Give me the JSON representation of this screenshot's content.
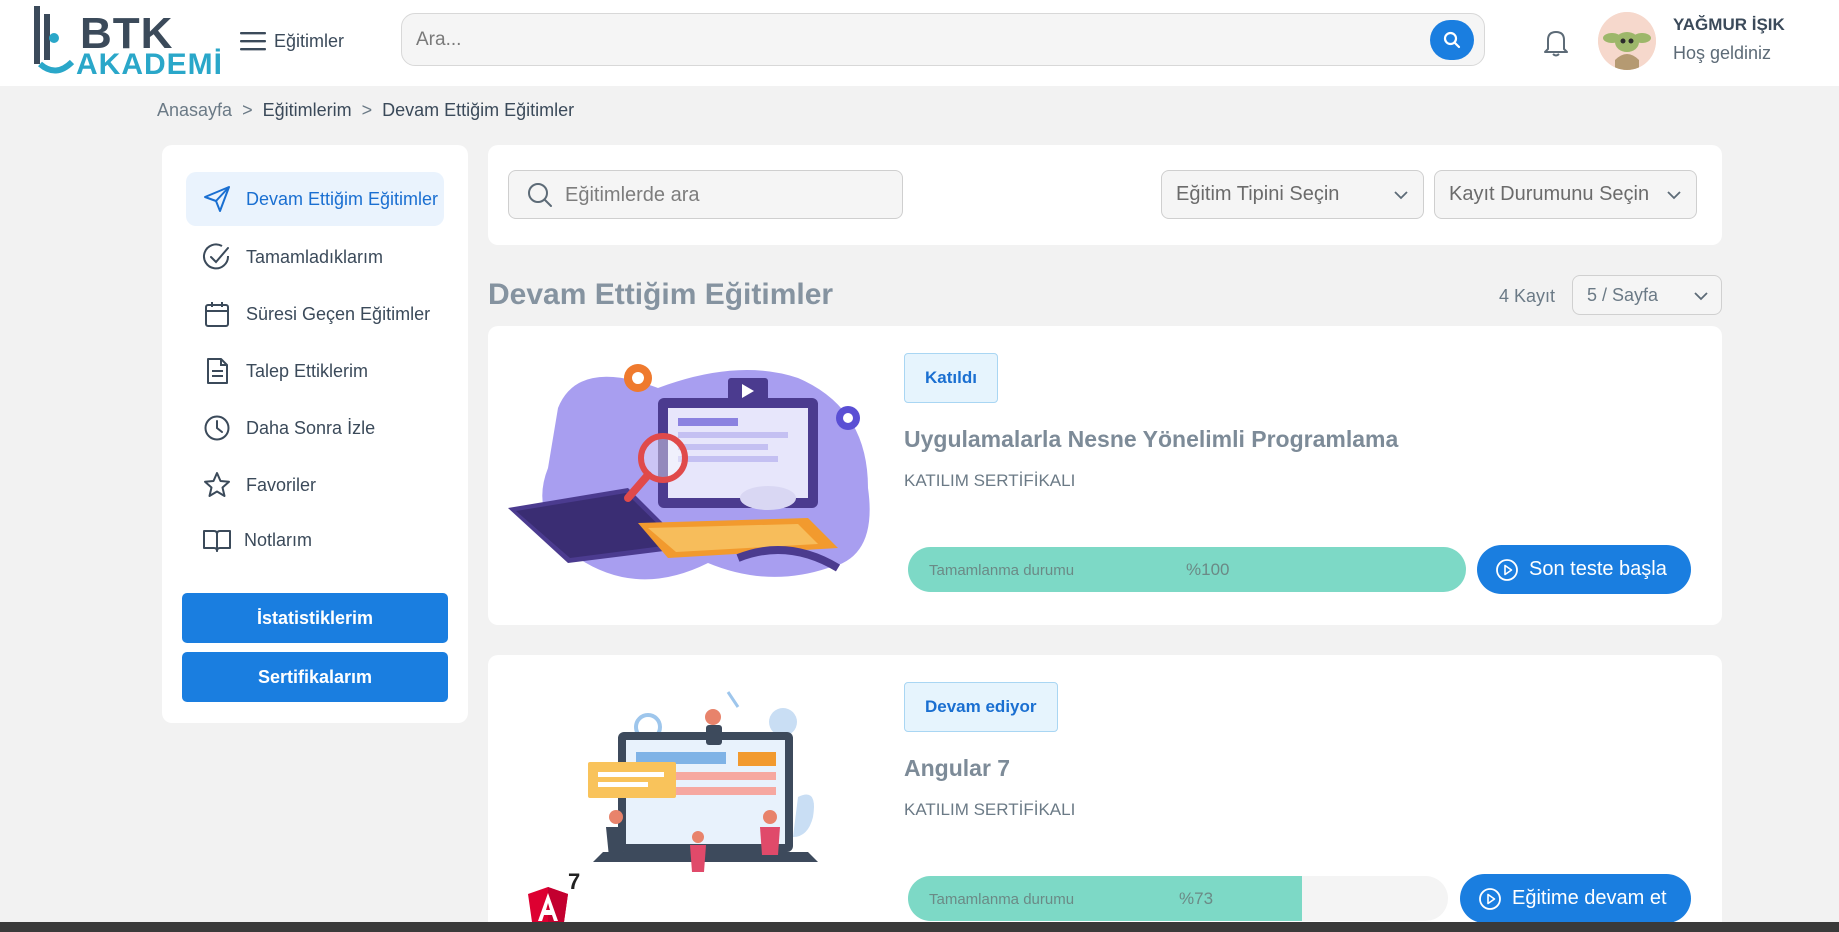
{
  "header": {
    "logo_top": "BTK",
    "logo_bottom": "AKADEMİ",
    "menu_label": "Eğitimler",
    "menu_icon": "hamburger-icon",
    "search_placeholder": "Ara...",
    "search_icon": "search-icon",
    "bell_icon": "bell-icon",
    "user_name": "YAĞMUR İŞIK",
    "user_greeting": "Hoş geldiniz"
  },
  "breadcrumb": {
    "items": [
      "Anasayfa",
      "Eğitimlerim",
      "Devam Ettiğim Eğitimler"
    ],
    "separator": ">"
  },
  "sidebar": {
    "items": [
      {
        "label": "Devam Ettiğim Eğitimler",
        "icon": "send-icon",
        "active": true
      },
      {
        "label": "Tamamladıklarım",
        "icon": "check-circle-icon",
        "active": false
      },
      {
        "label": "Süresi Geçen Eğitimler",
        "icon": "calendar-icon",
        "active": false
      },
      {
        "label": "Talep Ettiklerim",
        "icon": "document-icon",
        "active": false
      },
      {
        "label": "Daha Sonra İzle",
        "icon": "clock-icon",
        "active": false
      },
      {
        "label": "Favoriler",
        "icon": "star-icon",
        "active": false
      },
      {
        "label": "Notlarım",
        "icon": "book-icon",
        "active": false
      }
    ],
    "buttons": [
      "İstatistiklerim",
      "Sertifikalarım"
    ]
  },
  "filters": {
    "search_placeholder": "Eğitimlerde ara",
    "type_select": "Eğitim Tipini Seçin",
    "status_select": "Kayıt Durumunu Seçin"
  },
  "list": {
    "title": "Devam Ettiğim Eğitimler",
    "count": "4 Kayıt",
    "page_size": "5 / Sayfa"
  },
  "courses": [
    {
      "badge": "Katıldı",
      "title": "Uygulamalarla Nesne Yönelimli Programlama",
      "subtitle": "KATILIM SERTİFİKALI",
      "progress_label": "Tamamlanma durumu",
      "progress_text": "%100",
      "progress": 1.0,
      "action": "Son teste başla"
    },
    {
      "badge": "Devam ediyor",
      "title": "Angular 7",
      "subtitle": "KATILIM SERTİFİKALI",
      "progress_label": "Tamamlanma durumu",
      "progress_text": "%73",
      "progress": 0.73,
      "action": "Eğitime devam et",
      "logo_text": "7"
    }
  ],
  "colors": {
    "primary": "#1a7ee0",
    "progress_fill": "#7dd9c6",
    "badge_bg": "#e6f4fd",
    "page_bg": "#f2f2f2"
  }
}
